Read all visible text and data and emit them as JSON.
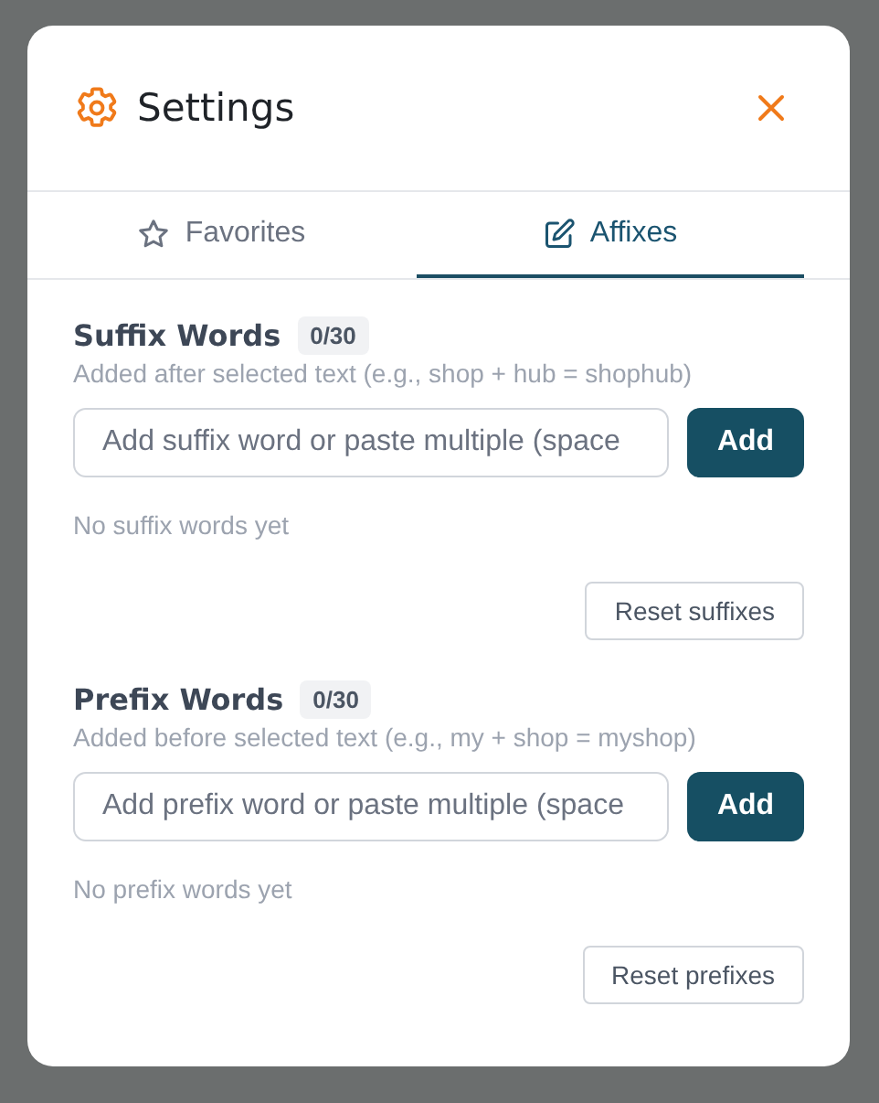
{
  "dialog": {
    "title": "Settings"
  },
  "tabs": [
    {
      "label": "Favorites",
      "kind": "star",
      "selected": false
    },
    {
      "label": "Affixes",
      "kind": "edit",
      "selected": true
    }
  ],
  "sections": [
    {
      "title": "Suffix Words",
      "count": "0/30",
      "description": "Added after selected text (e.g., shop + hub = shophub)",
      "placeholder": "Add suffix word or paste multiple (space",
      "add_button": "Add",
      "empty_text": "No suffix words yet",
      "reset_button": "Reset suffixes"
    },
    {
      "title": "Prefix Words",
      "count": "0/30",
      "description": "Added before selected text (e.g., my + shop = myshop)",
      "placeholder": "Add prefix word or paste multiple (space",
      "add_button": "Add",
      "empty_text": "No prefix words yet",
      "reset_button": "Reset prefixes"
    }
  ]
}
